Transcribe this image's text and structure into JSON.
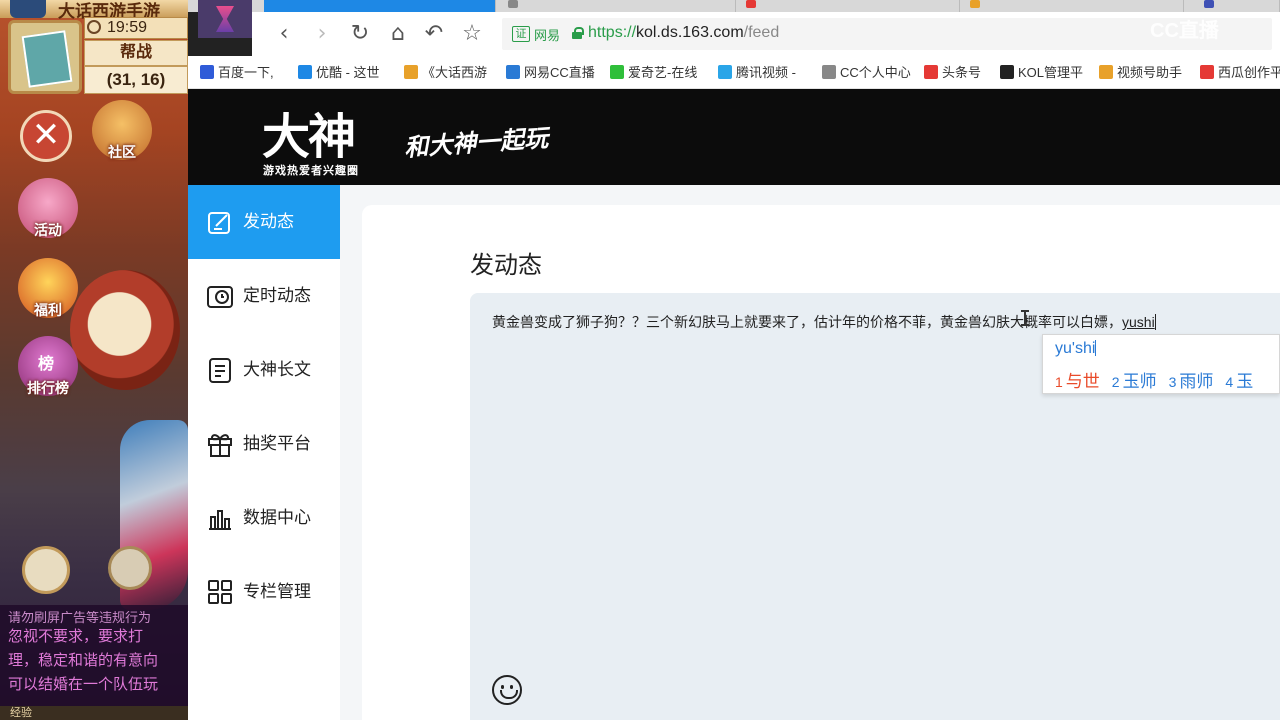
{
  "game": {
    "title": "大话西游手游",
    "time": "19:59",
    "mode": "帮战",
    "coords": "(31, 16)",
    "buttons": {
      "community": "社区",
      "activity": "活动",
      "welfare": "福利",
      "rank": "排行榜"
    },
    "rank_badge": "榜",
    "chat": [
      "请勿刷屏广告等违规行为",
      "忽视不要求，要求打",
      "理，稳定和谐的有意向",
      "可以结婚在一个队伍玩"
    ],
    "exp_label": "经验"
  },
  "browser": {
    "nav": {
      "back": "‹",
      "forward": "›",
      "reload": "↻",
      "home": "⌂",
      "undo": "↶",
      "bookmark": "☆"
    },
    "cert_icon": "证",
    "cert_label": "网易",
    "url": {
      "scheme": "https://",
      "domain": "kol.ds.163.com",
      "path": "/feed"
    },
    "cc_logo": "CC直播",
    "bookmarks": [
      {
        "label": "百度一下,",
        "color": "#2f5bd8"
      },
      {
        "label": "优酷 - 这世",
        "color": "#1e88e5"
      },
      {
        "label": "《大话西游",
        "color": "#e8a12a"
      },
      {
        "label": "网易CC直播",
        "color": "#2a7ad5"
      },
      {
        "label": "爱奇艺-在线",
        "color": "#2fbf3a"
      },
      {
        "label": "腾讯视频 -",
        "color": "#2aa5e8"
      },
      {
        "label": "CC个人中心",
        "color": "#888888"
      },
      {
        "label": "头条号",
        "color": "#e53935"
      },
      {
        "label": "KOL管理平",
        "color": "#222222"
      },
      {
        "label": "视频号助手",
        "color": "#e8a12a"
      },
      {
        "label": "西瓜创作平",
        "color": "#e53935"
      }
    ]
  },
  "header": {
    "logo": "大神",
    "logo_sub": "游戏热爱者兴趣圈",
    "slogan": "和大神一起玩"
  },
  "sidebar": {
    "items": [
      {
        "label": "发动态",
        "icon": "edit-icon",
        "active": true
      },
      {
        "label": "定时动态",
        "icon": "clock-calendar-icon"
      },
      {
        "label": "大神长文",
        "icon": "document-icon"
      },
      {
        "label": "抽奖平台",
        "icon": "gift-icon"
      },
      {
        "label": "数据中心",
        "icon": "bar-chart-icon"
      },
      {
        "label": "专栏管理",
        "icon": "grid-icon"
      }
    ]
  },
  "main": {
    "title": "发动态",
    "editor_text": "黄金兽变成了狮子狗？？三个新幻肤马上就要来了，估计年的价格不菲，黄金兽幻肤大概率可以白嫖，",
    "composing": "yushi"
  },
  "ime": {
    "input": "yu'shi",
    "candidates": [
      {
        "num": "1",
        "text": "与世"
      },
      {
        "num": "2",
        "text": "玉师"
      },
      {
        "num": "3",
        "text": "雨师"
      },
      {
        "num": "4",
        "text": "玉"
      }
    ]
  },
  "colors": {
    "accent": "#1e9cf0",
    "header_bg": "#0c0c0c",
    "ime_selected": "#e94b2a",
    "ime_text": "#2a7ad5"
  }
}
